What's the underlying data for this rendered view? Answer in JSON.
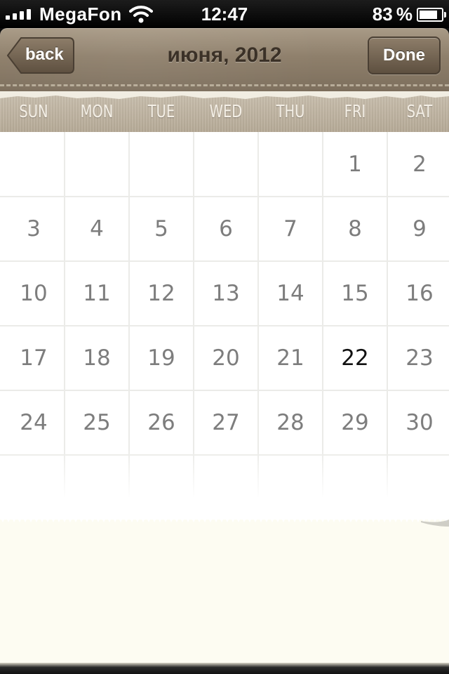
{
  "status_bar": {
    "carrier": "MegaFon",
    "time": "12:47",
    "battery_percent": "83 %",
    "battery_level": 0.83,
    "signal_icon": "signal-bars-icon",
    "wifi_icon": "wifi-icon",
    "battery_icon": "battery-icon"
  },
  "header": {
    "title": "июня, 2012",
    "back_label": "back",
    "done_label": "Done"
  },
  "weekdays": [
    "SUN",
    "MON",
    "TUE",
    "WED",
    "THU",
    "FRI",
    "SAT"
  ],
  "calendar": {
    "first_weekday_index": 5,
    "days": [
      "1",
      "2",
      "3",
      "4",
      "5",
      "6",
      "7",
      "8",
      "9",
      "10",
      "11",
      "12",
      "13",
      "14",
      "15",
      "16",
      "17",
      "18",
      "19",
      "20",
      "21",
      "22",
      "23",
      "24",
      "25",
      "26",
      "27",
      "28",
      "29",
      "30"
    ],
    "today": "22"
  },
  "colors": {
    "leather": "#8e7f6b",
    "paper": "#fdfcf2",
    "day_text": "#7d7d7d",
    "today_text": "#111111"
  }
}
